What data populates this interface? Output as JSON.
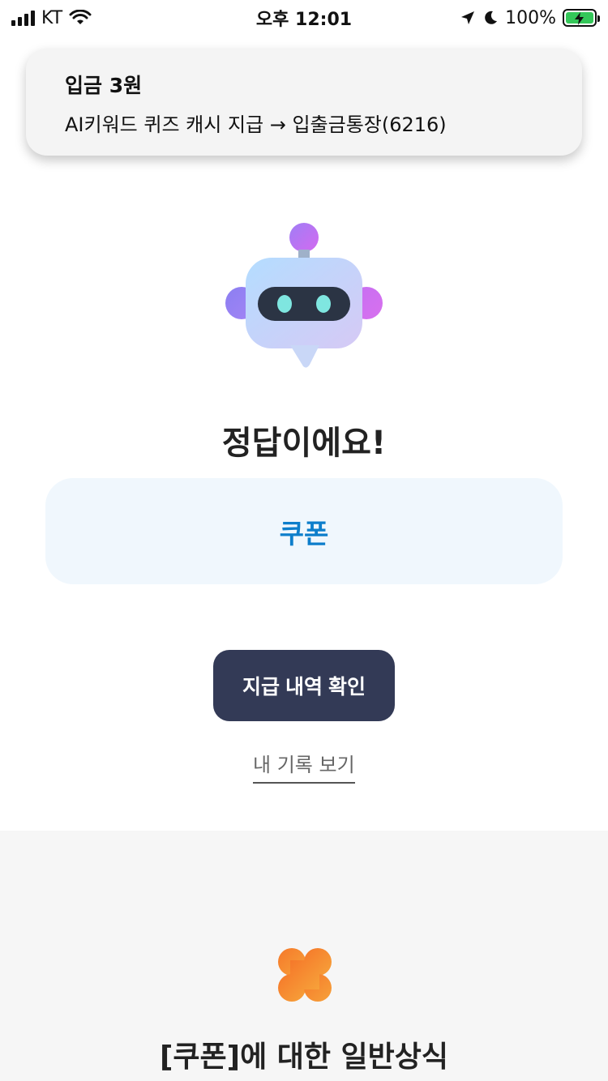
{
  "status_bar": {
    "carrier": "KT",
    "time": "오후 12:01",
    "battery_percent": "100%"
  },
  "notification": {
    "title": "입금 3원",
    "body": "AI키워드 퀴즈 캐시 지급 → 입출금통장(6216)"
  },
  "result": {
    "title": "정답이에요!",
    "answer": "쿠폰"
  },
  "actions": {
    "history_button": "지급 내역 확인",
    "my_records_link": "내 기록 보기"
  },
  "knowledge": {
    "title": "[쿠폰]에 대한 일반상식"
  },
  "colors": {
    "answer_text": "#0d7ecb",
    "button_bg": "#333a56",
    "clover": "#f58a2a"
  }
}
